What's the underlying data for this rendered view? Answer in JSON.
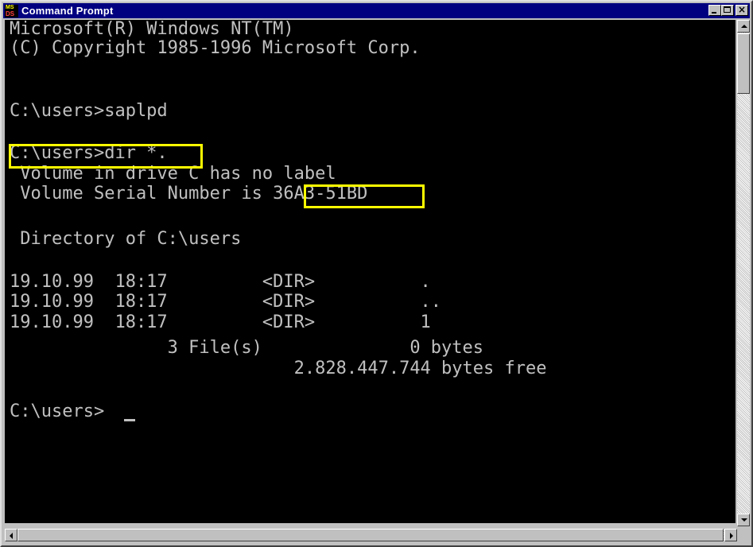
{
  "window": {
    "title": "Command Prompt",
    "icon_name": "ms-dos-icon",
    "icon_text_top": "MS",
    "icon_text_bottom": "DS"
  },
  "console": {
    "lines": [
      "Microsoft(R) Windows NT(TM)",
      "(C) Copyright 1985-1996 Microsoft Corp.",
      "",
      "C:\\users>saplpd",
      "",
      "C:\\users>dir *.",
      " Volume in drive C has no label",
      " Volume Serial Number is 36A3-51BD",
      "",
      " Directory of C:\\users",
      "",
      "19.10.99  18:17         <DIR>          .",
      "19.10.99  18:17         <DIR>          ..",
      "19.10.99  18:17         <DIR>          1",
      "               3 File(s)              0 bytes",
      "                           2.828.447.744 bytes free",
      "",
      "C:\\users>"
    ],
    "highlights": [
      "dir-command",
      "serial-number"
    ],
    "colors": {
      "background": "#000000",
      "text": "#c0c0c0",
      "highlight": "#ffff00"
    }
  },
  "controls": {
    "minimize_icon": "minimize-icon",
    "maximize_icon": "maximize-icon",
    "close_icon": "close-icon",
    "close_glyph": "×"
  }
}
